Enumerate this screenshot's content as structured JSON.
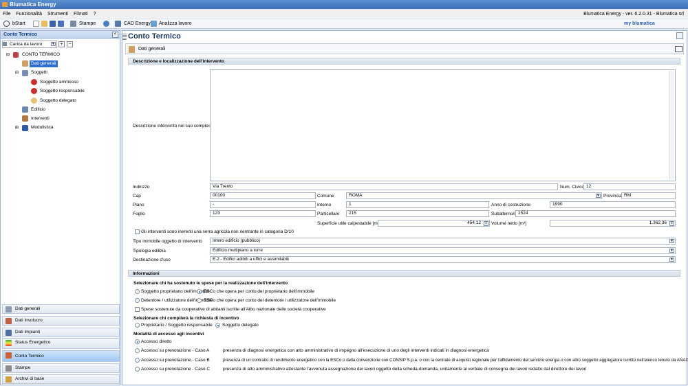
{
  "window": {
    "title": "Blumatica Energy",
    "version": "Blumatica Energy - ver. 6.2.0.31 - Blumatica srl"
  },
  "menu": [
    "File",
    "Funzionalità",
    "Strumenti",
    "Filmati",
    "?"
  ],
  "toolbar": {
    "start": "bStart",
    "stampe": "Stampe",
    "cad": "CAD Energy",
    "analizza": "Analizza lavoro",
    "brand": "my blumatica"
  },
  "left": {
    "header": "Conto Termico",
    "load": "Carica da lavoro",
    "tree": {
      "root": "CONTO TERMICO",
      "dati": "Dati generali",
      "soggetti": "Soggetti",
      "ammesso": "Soggetto ammesso",
      "responsabile": "Soggetto responsabile",
      "delegato": "Soggetto delegato",
      "edificio": "Edificio",
      "interventi": "Interventi",
      "modulistica": "Modulistica"
    },
    "nav": [
      "Dati generali",
      "Dati Involucro",
      "Dati Impianti",
      "Status Energetico",
      "Conto Termico",
      "Stampe",
      "Archivi di base"
    ]
  },
  "main": {
    "title": "Conto Termico",
    "bar": "Dati generali",
    "sec1": "Descrizione e localizzazione dell'intervento",
    "desc_label": "Descrizione intervento nel suo complesso",
    "labels": {
      "indirizzo": "Indirizzo",
      "civico": "Num. Civico",
      "cap": "Cap",
      "comune": "Comune",
      "provincia": "Provincia",
      "piano": "Piano",
      "interno": "Interno",
      "anno": "Anno di costruzione",
      "foglio": "Foglio",
      "particella": "Particella/e",
      "subalterno": "Subalterno/i",
      "superficie": "Superficie utile calpestabile [m²]",
      "volume": "Volume netto [m³]",
      "serra": "Gli interventi sono inerenti una serra agricola non rientrante in categoria D/10",
      "tipo": "Tipo immobile oggetto di intervento",
      "tipologia": "Tipologia edilizia",
      "destinazione": "Destinazione d'uso"
    },
    "values": {
      "indirizzo": "Via Trento",
      "civico": "12",
      "cap": "00100",
      "comune": "ROMA",
      "provincia": "RM",
      "piano": "-",
      "interno": "1",
      "anno": "1990",
      "foglio": "123",
      "particella": "215",
      "subalterno": "1524",
      "superficie": "454,12",
      "volume": "1.362,36",
      "tipo": "Intero edificio (pubblico)",
      "tipologia": "Edificio multipiano a torre",
      "destinazione": "E.2 - Edifici adibiti a uffici e assimilabili"
    },
    "sec2": "Informazioni",
    "q1": "Selezionare chi ha sostenuto le spese per la realizzazione dell'intervento",
    "r1": [
      "Soggetto proprietario dell'immobile",
      "ESCo che opera per conto del proprietario dell'immobile",
      "Detentore / utilizzatore dell'immobile",
      "ESCo che opera per conto del detentore / utilizzatore dell'immobile"
    ],
    "coop": "Spese sostenute da cooperative di abitanti iscritte all'Albo nazionale delle società cooperative",
    "q2": "Selezionare chi compilerà la richiesta di incentivo",
    "r2": [
      "Proprietario / Soggetto responsabile",
      "Soggetto delegato"
    ],
    "q3": "Modalità di accesso agli incentivi",
    "r3": [
      "Accesso diretto",
      "Accesso su prenotazione - Caso A",
      "Accesso su prenotazione - Caso B",
      "Accesso su prenotazione - Caso C"
    ],
    "r3desc": [
      "presenza di diagnosi energetica con atto amministrativo di impegno all'esecuzione di uno degli interventi indicati in diagnosi energetica",
      "presenza di un contratto di rendimento energetico con la ESCo o della convenzione con CONSIP S.p.a. o con la centrale di acquisti regionale per l'affidamento del servizio energia o con altro soggetto aggregatore iscritto nell'elenco tenuto da ANAC",
      "presenza di atto amministrativo attestante l'avvenuta assegnazione dei lavori oggetto della scheda-domanda, unitamente al verbale di consegna dei lavori redatto dal direttore dei lavori"
    ]
  }
}
